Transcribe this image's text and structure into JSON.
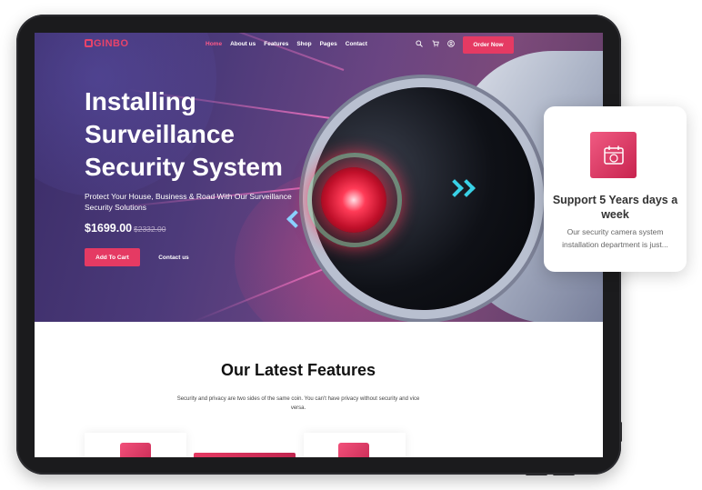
{
  "brand": {
    "name": "GINBO",
    "accent": "#e53a63"
  },
  "nav": {
    "links": [
      "Home",
      "About us",
      "Features",
      "Shop",
      "Pages",
      "Contact"
    ],
    "active_index": 0,
    "icons": [
      "search-icon",
      "cart-icon",
      "user-icon"
    ],
    "order_button": "Order Now"
  },
  "hero": {
    "title_lines": [
      "Installing",
      "Surveillance",
      "Security System"
    ],
    "subtitle": "Protect Your House, Business & Road With Our Surveillance Security Solutions",
    "price": "$1699.00",
    "old_price": "$2332.00",
    "cart_button": "Add To Cart",
    "contact_button": "Contact us"
  },
  "features": {
    "title": "Our Latest Features",
    "subtitle": "Security and privacy are two sides of the same coin. You can't have privacy without security and vice versa."
  },
  "support_card": {
    "icon": "calendar-24h-icon",
    "title": "Support 5 Years days a week",
    "text": "Our security camera system installation department is just..."
  }
}
